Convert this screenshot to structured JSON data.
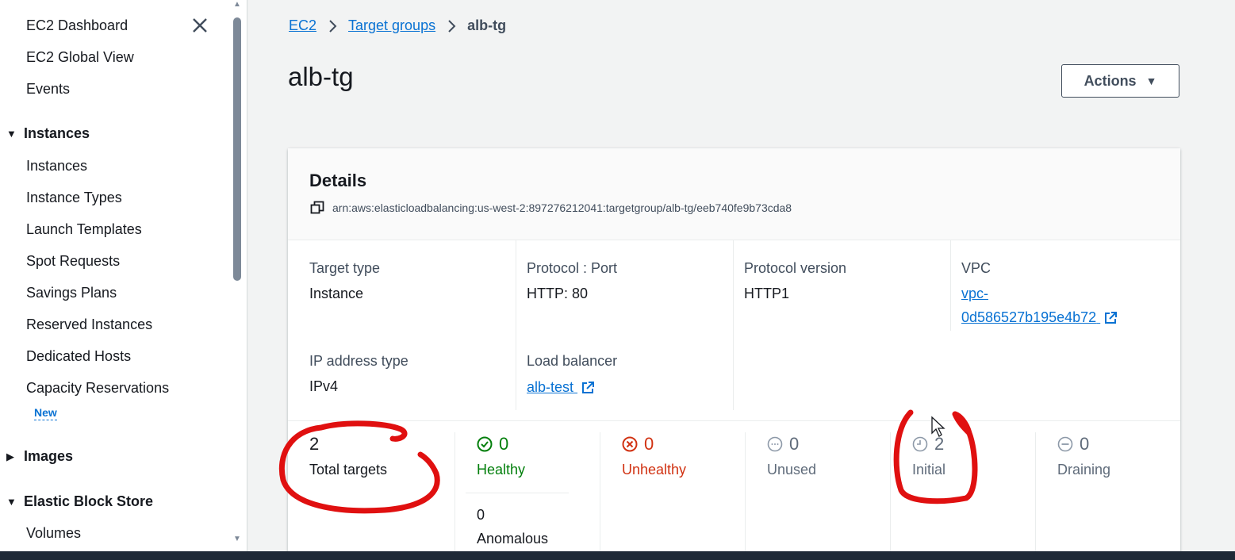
{
  "sidebar": {
    "items": [
      {
        "label": "EC2 Dashboard"
      },
      {
        "label": "EC2 Global View"
      },
      {
        "label": "Events"
      }
    ],
    "sections": {
      "instances": {
        "label": "Instances"
      },
      "images": {
        "label": "Images"
      },
      "ebs": {
        "label": "Elastic Block Store"
      }
    },
    "instances_items": [
      {
        "label": "Instances"
      },
      {
        "label": "Instance Types"
      },
      {
        "label": "Launch Templates"
      },
      {
        "label": "Spot Requests"
      },
      {
        "label": "Savings Plans"
      },
      {
        "label": "Reserved Instances"
      },
      {
        "label": "Dedicated Hosts"
      },
      {
        "label": "Capacity Reservations"
      }
    ],
    "new_badge": "New",
    "ebs_items": [
      {
        "label": "Volumes"
      }
    ]
  },
  "breadcrumb": {
    "root": "EC2",
    "parent": "Target groups",
    "current": "alb-tg"
  },
  "page": {
    "title": "alb-tg",
    "actions_label": "Actions"
  },
  "details": {
    "title": "Details",
    "arn": "arn:aws:elasticloadbalancing:us-west-2:897276212041:targetgroup/alb-tg/eeb740fe9b73cda8",
    "fields": {
      "target_type": {
        "label": "Target type",
        "value": "Instance"
      },
      "protocol_port": {
        "label": "Protocol : Port",
        "value": "HTTP: 80"
      },
      "protocol_version": {
        "label": "Protocol version",
        "value": "HTTP1"
      },
      "vpc": {
        "label": "VPC",
        "value_line1": "vpc-",
        "value_line2": "0d586527b195e4b72"
      },
      "ip_type": {
        "label": "IP address type",
        "value": "IPv4"
      },
      "load_balancer": {
        "label": "Load balancer",
        "value": "alb-test"
      }
    }
  },
  "stats": {
    "total": {
      "count": "2",
      "label": "Total targets"
    },
    "healthy": {
      "count": "0",
      "label": "Healthy",
      "color": "#037f0c"
    },
    "unhealthy": {
      "count": "0",
      "label": "Unhealthy",
      "color": "#d13212"
    },
    "unused": {
      "count": "0",
      "label": "Unused",
      "color": "#5f6b7a"
    },
    "initial": {
      "count": "2",
      "label": "Initial",
      "color": "#5f6b7a"
    },
    "draining": {
      "count": "0",
      "label": "Draining",
      "color": "#5f6b7a"
    },
    "anomalous": {
      "count": "0",
      "label": "Anomalous"
    }
  },
  "colors": {
    "link": "#0972d3",
    "annotation": "#e01010"
  }
}
